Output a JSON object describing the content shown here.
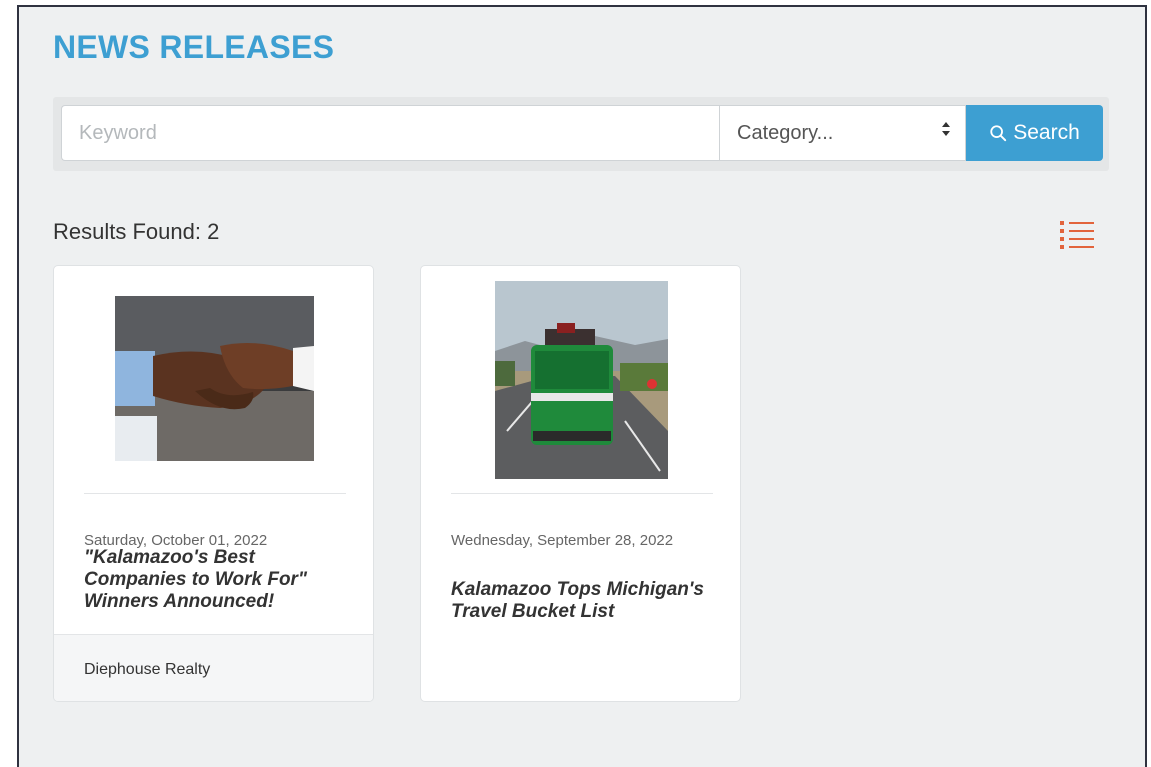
{
  "page": {
    "title": "NEWS RELEASES"
  },
  "search": {
    "keyword_placeholder": "Keyword",
    "keyword_value": "",
    "category_selected": "Category...",
    "button_label": "Search"
  },
  "results": {
    "label": "Results Found:  2",
    "count": 2
  },
  "cards": [
    {
      "date": "Saturday, October 01, 2022",
      "title": "\"Kalamazoo's Best Companies to Work For\" Winners Announced!",
      "footer": "Diephouse Realty",
      "image": "handshake-photo"
    },
    {
      "date": "Wednesday, September 28, 2022",
      "title": "Kalamazoo Tops Michigan's Travel Bucket List",
      "image": "green-van-road-photo"
    }
  ],
  "colors": {
    "accent": "#3d9fd2",
    "list_icon": "#e2643c",
    "background": "#eef0f1"
  },
  "icons": {
    "search": "search-icon",
    "list_view": "list-view-icon",
    "select_arrows": "sort-arrows-icon"
  }
}
